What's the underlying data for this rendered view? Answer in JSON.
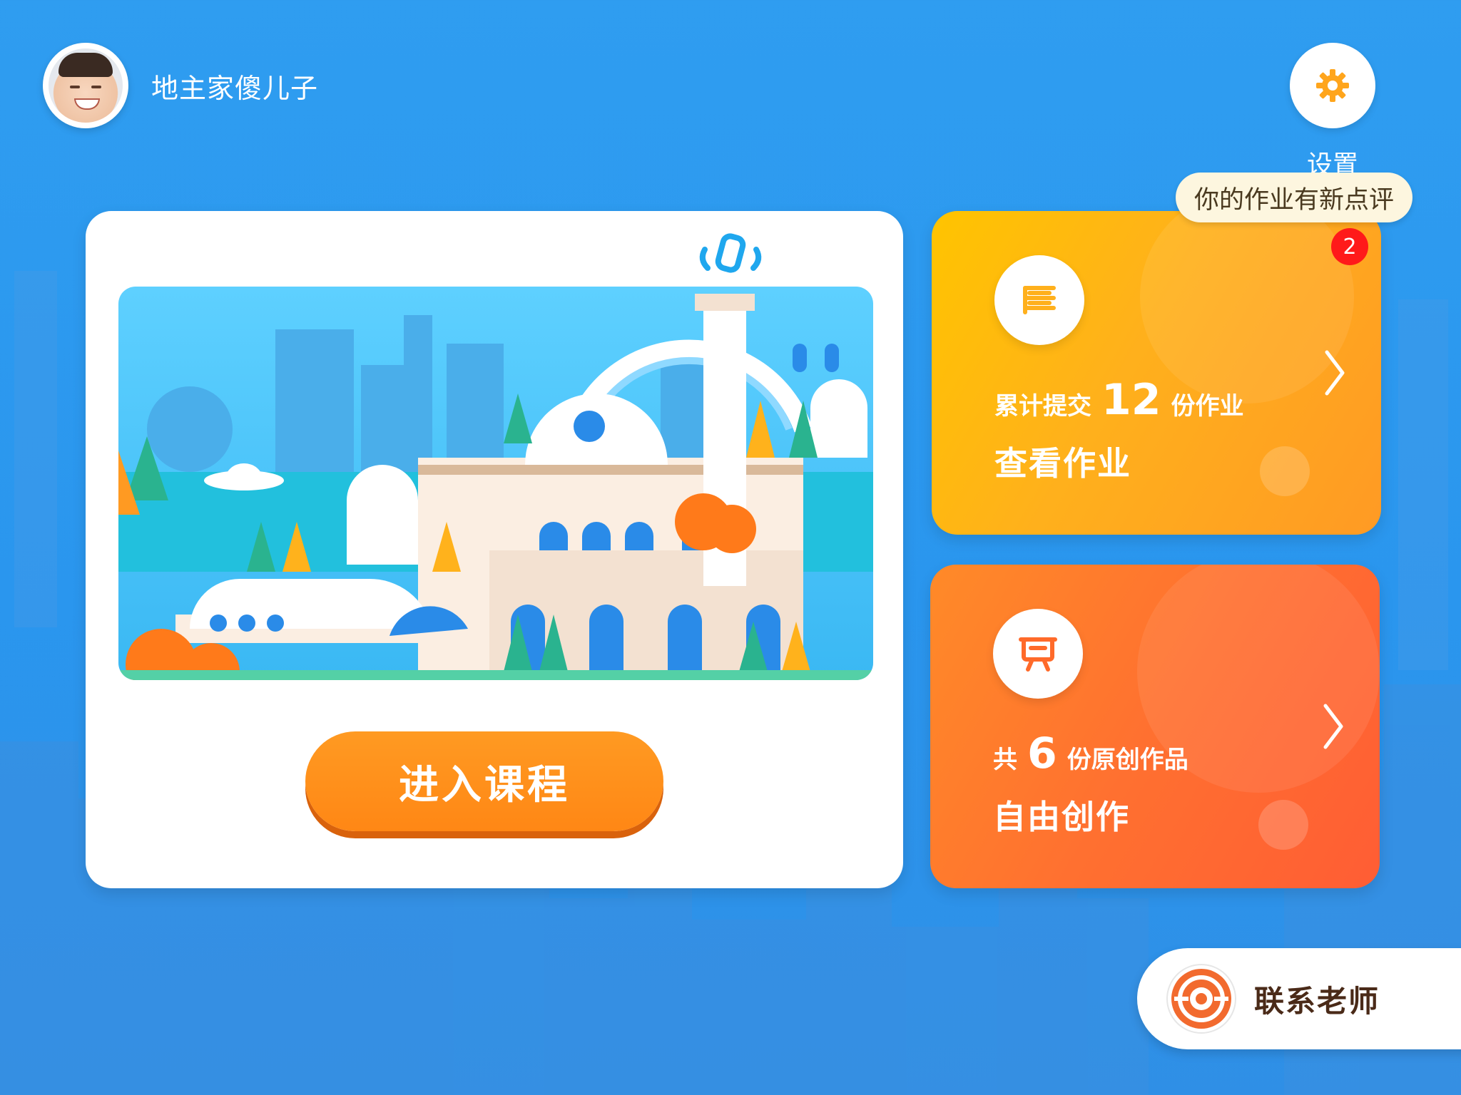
{
  "header": {
    "username": "地主家傻儿子",
    "settings_label": "设置"
  },
  "notification": {
    "tooltip": "你的作业有新点评",
    "badge_count": "2"
  },
  "course": {
    "enter_label": "进入课程"
  },
  "homework_card": {
    "prefix": "累计提交",
    "count": "12",
    "suffix": "份作业",
    "title": "查看作业"
  },
  "creation_card": {
    "prefix": "共",
    "count": "6",
    "suffix": "份原创作品",
    "title": "自由创作"
  },
  "contact": {
    "label": "联系老师"
  },
  "colors": {
    "background": "#2f9df0",
    "homework_gradient": [
      "#ffc400",
      "#ff9a24"
    ],
    "creation_gradient": [
      "#ff8a28",
      "#ff5d34"
    ],
    "enter_button": "#ff8715",
    "badge": "#ff1a1a"
  },
  "icons": {
    "settings": "gear-icon",
    "homework": "book-stack-icon",
    "creation": "easel-icon",
    "chevron": "chevron-right-icon",
    "contact": "teacher-logo-icon"
  }
}
